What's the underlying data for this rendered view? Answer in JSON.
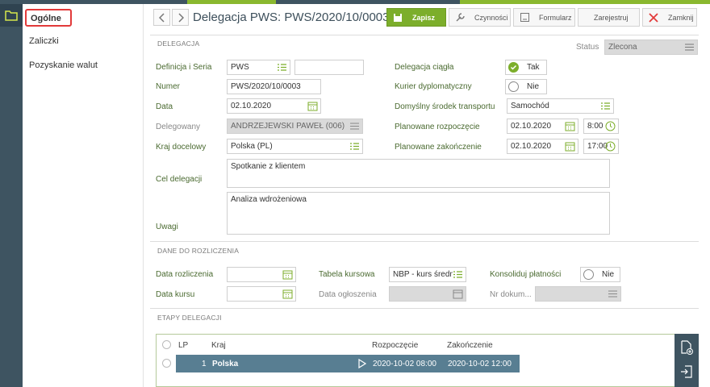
{
  "colors": {
    "accent_green": "#7cae2b",
    "dark": "#3e5461",
    "row_selected": "#587e92",
    "highlight": "#e23a3a"
  },
  "nav": {
    "items": [
      {
        "label": "Ogólne"
      },
      {
        "label": "Zaliczki"
      },
      {
        "label": "Pozyskanie walut"
      }
    ]
  },
  "header": {
    "title": "Delegacja PWS: PWS/2020/10/0003",
    "buttons": {
      "save": "Zapisz",
      "actions": "Czynności",
      "form": "Formularz",
      "register": "Zarejestruj",
      "close": "Zamknij"
    }
  },
  "delegacja": {
    "section_title": "DELEGACJA",
    "status_label": "Status",
    "status_value": "Zlecona",
    "definicja_label": "Definicja i Seria",
    "definicja_value": "PWS",
    "seria_value": "",
    "numer_label": "Numer",
    "numer_value": "PWS/2020/10/0003",
    "data_label": "Data",
    "data_value": "02.10.2020",
    "delegowany_label": "Delegowany",
    "delegowany_value": "ANDRZEJEWSKI PAWEŁ (006)",
    "kraj_label": "Kraj docelowy",
    "kraj_value": "Polska (PL)",
    "cel_label": "Cel delegacji",
    "cel_value": "Spotkanie z klientem",
    "uwagi_label": "Uwagi",
    "uwagi_value": "Analiza wdrożeniowa",
    "ciagla_label": "Delegacja ciągła",
    "ciagla_value": "Tak",
    "kurier_label": "Kurier dyplomatyczny",
    "kurier_value": "Nie",
    "transport_label": "Domyślny środek transportu",
    "transport_value": "Samochód",
    "plan_start_label": "Planowane rozpoczęcie",
    "plan_start_date": "02.10.2020",
    "plan_start_time": "8:00",
    "plan_end_label": "Planowane zakończenie",
    "plan_end_date": "02.10.2020",
    "plan_end_time": "17:00"
  },
  "rozliczenie": {
    "section_title": "DANE DO ROZLICZENIA",
    "data_rozl_label": "Data rozliczenia",
    "data_rozl_value": "",
    "data_kursu_label": "Data kursu",
    "data_kursu_value": "",
    "tabela_label": "Tabela kursowa",
    "tabela_value": "NBP - kurs średni (",
    "data_ogl_label": "Data ogłoszenia",
    "data_ogl_value": "",
    "konsoliduj_label": "Konsoliduj płatności",
    "konsoliduj_value": "Nie",
    "nr_dok_label": "Nr dokum...",
    "nr_dok_value": ""
  },
  "etapy": {
    "section_title": "ETAPY DELEGACJI",
    "columns": {
      "lp": "LP",
      "kraj": "Kraj",
      "start": "Rozpoczęcie",
      "end": "Zakończenie"
    },
    "rows": [
      {
        "lp": "1",
        "kraj": "Polska",
        "start": "2020-10-02 08:00",
        "end": "2020-10-02 12:00"
      }
    ]
  }
}
